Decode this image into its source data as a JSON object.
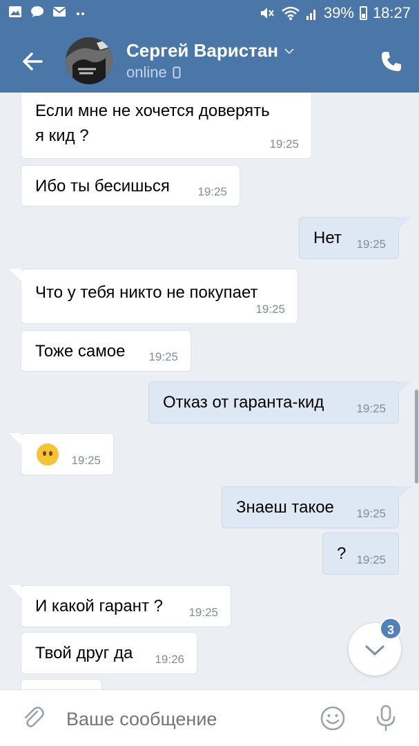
{
  "status_bar": {
    "battery": "39%",
    "time": "18:27",
    "icons": [
      "image-icon",
      "chat-icon",
      "mail-icon",
      "dots-icon",
      "mute-icon",
      "wifi-icon",
      "signal-icon",
      "battery-icon"
    ]
  },
  "header": {
    "name": "Сергей Варистан",
    "status": "online"
  },
  "messages": [
    {
      "dir": "in",
      "text": "Если мне не хочется доверять",
      "text2": "я кид ?",
      "time": "19:25"
    },
    {
      "dir": "in",
      "text": "Ибо ты бесишься",
      "time": "19:25"
    },
    {
      "dir": "out",
      "text": "Нет",
      "time": "19:25"
    },
    {
      "dir": "in",
      "text": "Что у тебя никто не покупает",
      "time": "19:25"
    },
    {
      "dir": "in",
      "text": "Тоже самое",
      "time": "19:25"
    },
    {
      "dir": "out",
      "text": "Отказ от гаранта-кид",
      "time": "19:25"
    },
    {
      "dir": "in",
      "emoji": "neutral-face-icon",
      "time": "19:25"
    },
    {
      "dir": "out",
      "text": "Знаеш такое",
      "time": "19:25"
    },
    {
      "dir": "out",
      "text": "?",
      "time": "19:25"
    },
    {
      "dir": "in",
      "text": "И какой гарант ?",
      "time": "19:25"
    },
    {
      "dir": "in",
      "text": "Твой друг да",
      "time": "19:26"
    }
  ],
  "unread_badge": "3",
  "input": {
    "placeholder": "Ваше сообщение"
  },
  "colors": {
    "header_bg": "#4a76a8",
    "chat_bg": "#ebeff3",
    "outgoing_bg": "#dee8f4",
    "incoming_bg": "#ffffff",
    "accent": "#5181b8"
  }
}
